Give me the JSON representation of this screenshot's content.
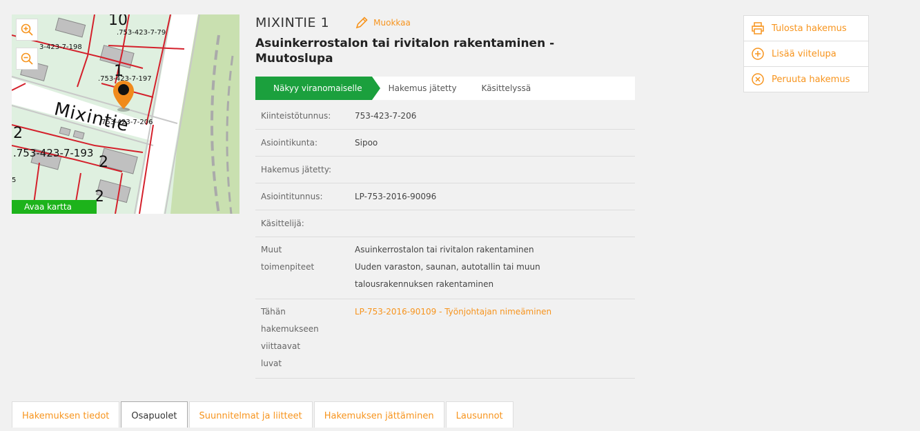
{
  "map": {
    "labels": [
      ".753-423-7-79",
      "3-423-7-198",
      ".753-423-7-197",
      "753-423-7-206",
      ".753-423-7-193",
      "Mixintie",
      "1",
      "2",
      "2",
      "2",
      "5",
      "10"
    ],
    "open_map_label": "Avaa kartta",
    "zoom_in_icon": "zoom-in-icon",
    "zoom_out_icon": "zoom-out-icon"
  },
  "header": {
    "street": "MIXINTIE 1",
    "edit_label": "Muokkaa",
    "operation": "Asuinkerrostalon tai rivitalon rakentaminen - Muutoslupa"
  },
  "status": {
    "active": "Näkyy viranomaiselle",
    "steps": [
      "Hakemus jätetty",
      "Käsittelyssä"
    ],
    "active_color": "#1ba03d"
  },
  "info": {
    "property_id_label": "Kiinteistötunnus:",
    "property_id": "753-423-7-206",
    "municipality_label": "Asiointikunta:",
    "municipality": "Sipoo",
    "submitted_label": "Hakemus jätetty:",
    "submitted": "",
    "case_id_label": "Asiointitunnus:",
    "case_id": "LP-753-2016-90096",
    "handler_label": "Käsittelijä:",
    "handler": "",
    "other_ops_label": "Muut toimenpiteet",
    "other_ops": [
      "Asuinkerrostalon tai rivitalon rakentaminen",
      "Uuden varaston, saunan, autotallin tai muun talousrakennuksen rakentaminen"
    ],
    "linked_label": "Tähän hakemukseen viittaavat luvat",
    "linked": "LP-753-2016-90109 - Työnjohtajan nimeäminen"
  },
  "actions": [
    {
      "label": "Tulosta hakemus",
      "icon": "print-icon"
    },
    {
      "label": "Lisää viitelupa",
      "icon": "add-circle-icon"
    },
    {
      "label": "Peruuta hakemus",
      "icon": "cancel-circle-icon"
    }
  ],
  "tabs": [
    "Hakemuksen tiedot",
    "Osapuolet",
    "Suunnitelmat ja liitteet",
    "Hakemuksen jättäminen",
    "Lausunnot"
  ],
  "colors": {
    "accent": "#f7941d",
    "map_button": "#1db31b",
    "map_road": "#d4202b"
  }
}
